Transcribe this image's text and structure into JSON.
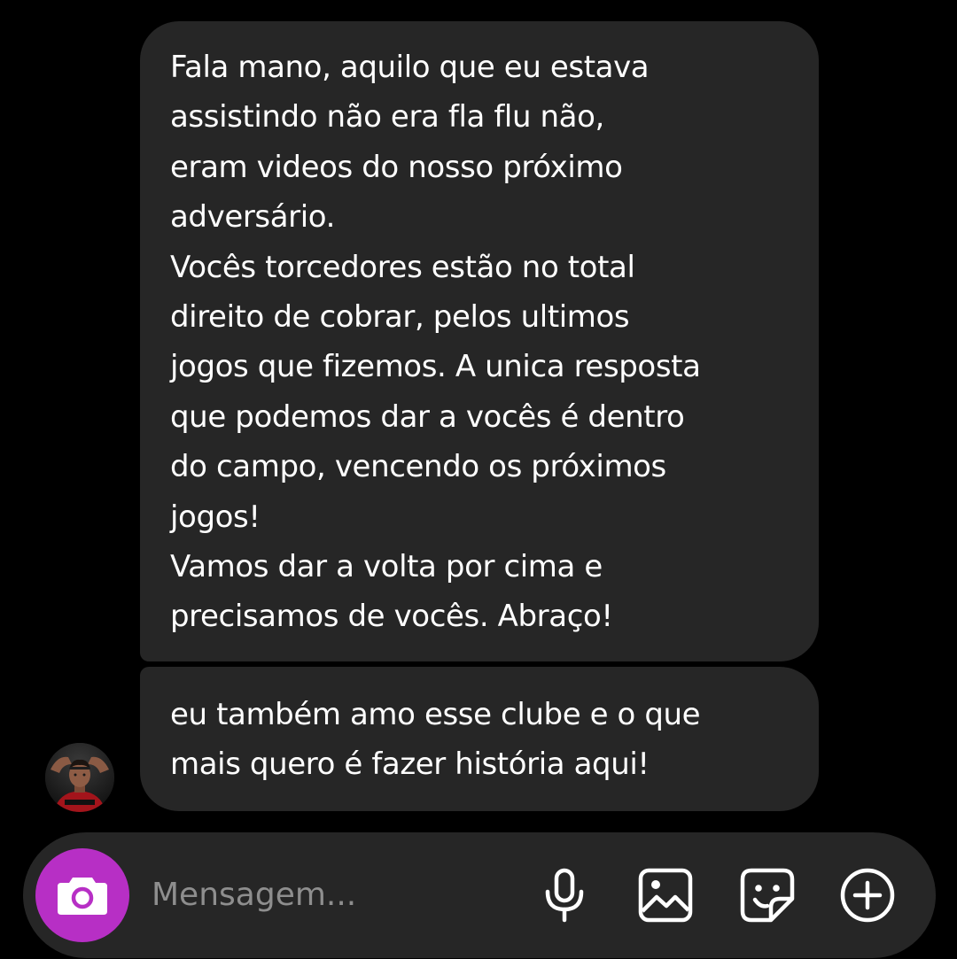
{
  "thread": {
    "messages": [
      {
        "lines": [
          "Fala mano, aquilo que eu estava",
          "assistindo não era fla flu não,",
          "eram videos do nosso próximo",
          "adversário.",
          "Vocês torcedores estão no total",
          "direito de cobrar, pelos ultimos",
          "jogos que fizemos. A unica resposta",
          "que podemos dar a vocês é dentro",
          "do campo, vencendo os próximos",
          "jogos!",
          "Vamos dar a volta por cima e",
          "precisamos de vocês. Abraço!"
        ]
      },
      {
        "lines": [
          "eu também amo esse clube e o que",
          "mais quero é fazer história aqui!"
        ]
      }
    ]
  },
  "composer": {
    "placeholder": "Mensagem...",
    "value": "",
    "accent_color": "#b72fc5",
    "icons": [
      "camera-icon",
      "microphone-icon",
      "gallery-icon",
      "sticker-icon",
      "add-icon"
    ]
  },
  "colors": {
    "background": "#000000",
    "bubble": "#262626",
    "text": "#ffffff",
    "placeholder": "#8e8e8e"
  }
}
